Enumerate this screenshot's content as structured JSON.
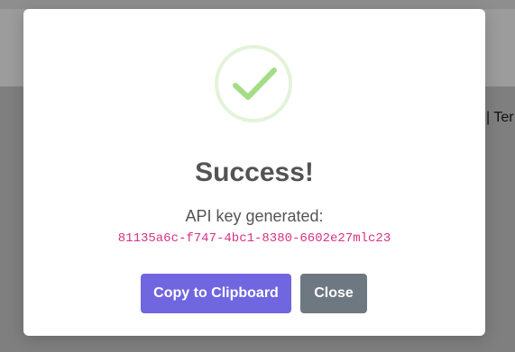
{
  "background": {
    "nav_text": "| Ter"
  },
  "modal": {
    "icon": "check-icon",
    "title": "Success!",
    "message": "API key generated:",
    "api_key": "81135a6c-f747-4bc1-8380-6602e27mlc23",
    "buttons": {
      "copy_label": "Copy to Clipboard",
      "close_label": "Close"
    }
  },
  "colors": {
    "success_green": "#a5dc86",
    "success_ring": "#e3f3da",
    "confirm_button": "#7066e0",
    "cancel_button": "#6e7881",
    "code_pink": "#d63384",
    "text": "#545454"
  }
}
